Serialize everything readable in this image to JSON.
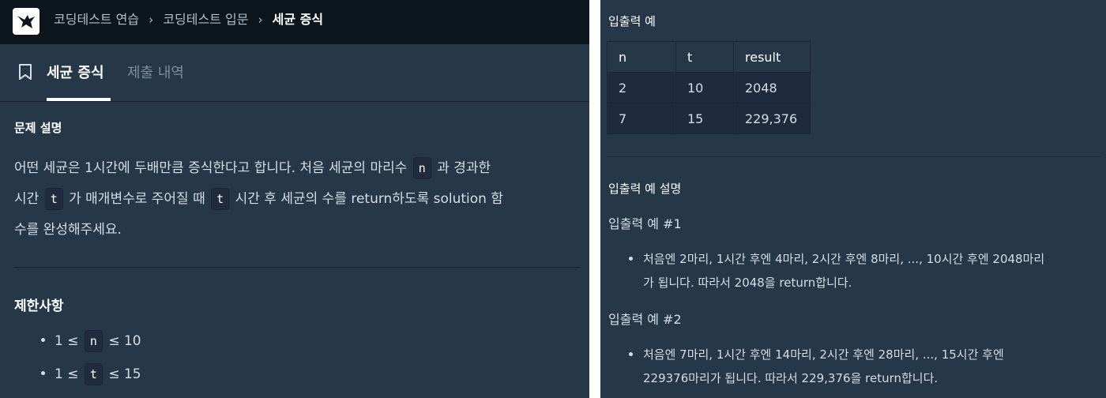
{
  "header": {
    "breadcrumbs": [
      "코딩테스트 연습",
      "코딩테스트 입문",
      "세균 증식"
    ]
  },
  "tabs": [
    {
      "label": "세균 증식",
      "active": true
    },
    {
      "label": "제출 내역",
      "active": false
    }
  ],
  "problem": {
    "heading": "문제 설명",
    "p1_a": "어떤 세균은 1시간에 두배만큼 증식한다고 합니다. 처음 세균의 마리수",
    "p1_code1": "n",
    "p1_b": "과 경과한",
    "p2_a": "시간",
    "p2_code2": "t",
    "p2_b": "가 매개변수로 주어질 때",
    "p2_code3": "t",
    "p2_c": "시간 후 세균의 수를 return하도록 solution 함",
    "p3": "수를 완성해주세요."
  },
  "constraints": {
    "heading": "제한사항",
    "items": [
      {
        "pre": "1 ≤",
        "code": "n",
        "post": "≤ 10"
      },
      {
        "pre": "1 ≤",
        "code": "t",
        "post": "≤ 15"
      }
    ]
  },
  "io_example": {
    "heading": "입출력 예",
    "columns": [
      "n",
      "t",
      "result"
    ],
    "rows": [
      [
        "2",
        "10",
        "2048"
      ],
      [
        "7",
        "15",
        "229,376"
      ]
    ]
  },
  "io_explanation": {
    "heading": "입출력 예 설명",
    "case1_title": "입출력 예 #1",
    "case1_line1": "처음엔 2마리, 1시간 후엔 4마리, 2시간 후엔 8마리, ..., 10시간 후엔 2048마리",
    "case1_line2": "가 됩니다. 따라서 2048을 return합니다.",
    "case2_title": "입출력 예 #2",
    "case2_line1": "처음엔 7마리, 1시간 후엔 14마리, 2시간 후엔 28마리, ..., 15시간 후엔",
    "case2_line2": "229376마리가 됩니다. 따라서 229,376을 return합니다."
  },
  "colors": {
    "panel_bg": "#263747",
    "topbar_bg": "#0c151c",
    "text": "#d5dde6",
    "code_bg": "#202b3d"
  }
}
